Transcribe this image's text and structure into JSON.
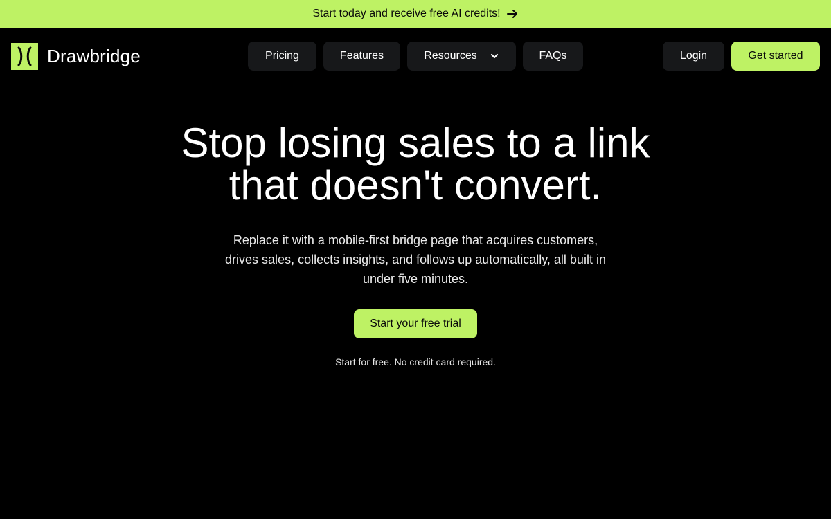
{
  "announcement": {
    "text": "Start today and receive free AI credits!",
    "icon": "arrow-right-icon"
  },
  "brand": {
    "name": "Drawbridge",
    "logo_icon": "drawbridge-logo-icon"
  },
  "nav": {
    "items": [
      {
        "label": "Pricing"
      },
      {
        "label": "Features"
      },
      {
        "label": "Resources",
        "icon": "chevron-down-icon"
      },
      {
        "label": "FAQs"
      }
    ],
    "login_label": "Login",
    "get_started_label": "Get started"
  },
  "hero": {
    "title_line1": "Stop losing sales to a link",
    "title_line2": "that doesn't convert.",
    "subtitle": "Replace it with a mobile-first bridge page that acquires customers, drives sales, collects insights, and follows up automatically, all built in under five minutes.",
    "cta_label": "Start your free trial",
    "note": "Start for free. No credit card required."
  },
  "colors": {
    "accent": "#bef264",
    "background": "#000000",
    "nav_button_bg": "#17181a"
  }
}
